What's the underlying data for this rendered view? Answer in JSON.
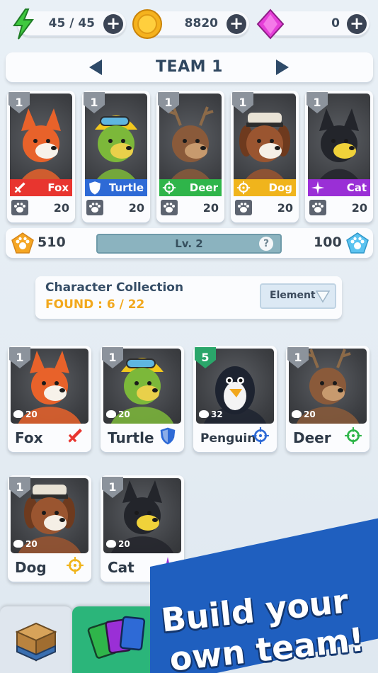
{
  "resources": {
    "energy": "45 / 45",
    "coins": "8820",
    "gems": "0",
    "plus": "+"
  },
  "team": {
    "title": "TEAM 1",
    "members": [
      {
        "level": "1",
        "name": "Fox",
        "element": "sword",
        "color": "#e8352f",
        "power": "20"
      },
      {
        "level": "1",
        "name": "Turtle",
        "element": "shield",
        "color": "#2e6ad6",
        "power": "20"
      },
      {
        "level": "1",
        "name": "Deer",
        "element": "target",
        "color": "#2fb54a",
        "power": "20"
      },
      {
        "level": "1",
        "name": "Dog",
        "element": "target",
        "color": "#f0b41c",
        "power": "20"
      },
      {
        "level": "1",
        "name": "Cat",
        "element": "star",
        "color": "#9a2fd6",
        "power": "20"
      }
    ]
  },
  "level_row": {
    "left_value": "510",
    "right_value": "100",
    "level_label": "Lv. 2",
    "help": "?",
    "progress": 0.0
  },
  "collection": {
    "title": "Character Collection",
    "found": "FOUND : 6 / 22",
    "filter_label": "Element",
    "cards": [
      {
        "level": "1",
        "name": "Fox",
        "power": "20",
        "element": "sword",
        "color": "#e8352f",
        "badge": "gray"
      },
      {
        "level": "1",
        "name": "Turtle",
        "power": "20",
        "element": "shield",
        "color": "#2e6ad6",
        "badge": "gray"
      },
      {
        "level": "5",
        "name": "Penguin",
        "power": "32",
        "element": "target",
        "color": "#2e6ad6",
        "badge": "green"
      },
      {
        "level": "1",
        "name": "Deer",
        "power": "20",
        "element": "target",
        "color": "#2fb54a",
        "badge": "gray"
      },
      {
        "level": "1",
        "name": "Dog",
        "power": "20",
        "element": "target",
        "color": "#f0b41c",
        "badge": "gray"
      },
      {
        "level": "1",
        "name": "Cat",
        "power": "20",
        "element": "star",
        "color": "#9a2fd6",
        "badge": "gray"
      }
    ]
  },
  "banner": {
    "line1": "Build your",
    "line2": "own team!"
  }
}
